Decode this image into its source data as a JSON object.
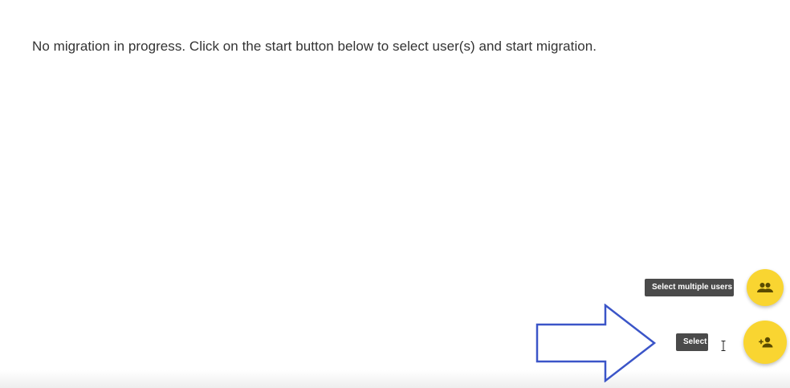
{
  "main": {
    "status_message": "No migration in progress. Click on the start button below to select user(s) and start migration."
  },
  "actions": {
    "select_multiple": {
      "tooltip": "Select multiple users",
      "icon": "group-icon"
    },
    "select_single": {
      "tooltip": "Select user",
      "icon": "person-add-icon"
    }
  },
  "colors": {
    "fab": "#f9d531",
    "tooltip_bg": "#4a4a4a",
    "arrow_outline": "#3b55c8"
  }
}
